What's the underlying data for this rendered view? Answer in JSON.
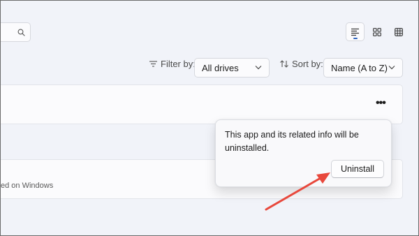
{
  "search": {
    "icon": "search-icon"
  },
  "view_toggles": [
    {
      "icon": "list-view-icon",
      "active": true
    },
    {
      "icon": "tile-view-icon",
      "active": false
    },
    {
      "icon": "grid-view-icon",
      "active": false
    }
  ],
  "filter": {
    "label": "Filter by:",
    "value": "All drives",
    "icon": "filter-icon"
  },
  "sort": {
    "label": "Sort by:",
    "value": "Name (A to Z)",
    "icon": "sort-icon"
  },
  "apps": {
    "more_label": "•••",
    "partial_subtitle": "ed on Windows"
  },
  "flyout": {
    "message": "This app and its related info will be uninstalled.",
    "button_label": "Uninstall"
  },
  "annotation": {
    "arrow_color": "#e8483c"
  },
  "colors": {
    "accent": "#2a62bf",
    "background": "#f1f3f9"
  }
}
